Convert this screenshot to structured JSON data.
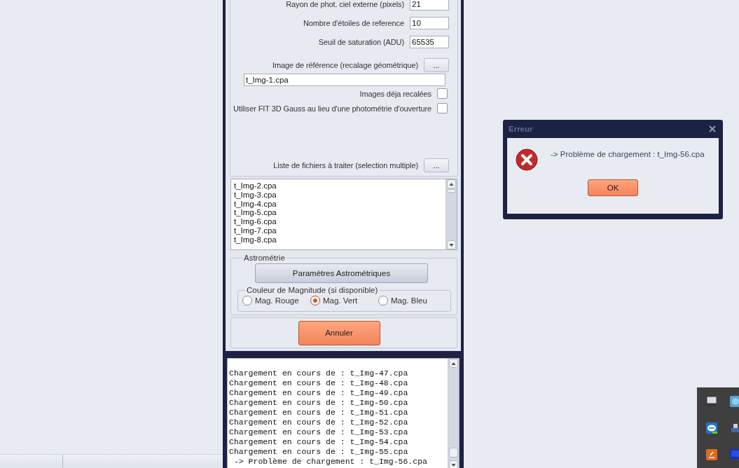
{
  "settings_window": {
    "fields": [
      {
        "label": "Rayon de phot. ciel externe (pixels)",
        "value": "21"
      },
      {
        "label": "Nombre d'étoiles de reference",
        "value": "10"
      },
      {
        "label": "Seuil de saturation (ADU)",
        "value": "65535"
      }
    ],
    "reference_image": {
      "label": "Image de référence (recalage géométrique)",
      "button": "...",
      "value": "t_Img-1.cpa"
    },
    "checkboxes": [
      {
        "label": "Images déja recalées",
        "checked": false
      },
      {
        "label": "Utiliser FIT 3D Gauss au lieu d'une photométrie d'ouverture",
        "checked": false
      }
    ],
    "file_list": {
      "label": "Liste de fichiers à traiter (selection multiple)",
      "button": "...",
      "items": [
        "t_Img-2.cpa",
        "t_Img-3.cpa",
        "t_Img-4.cpa",
        "t_Img-5.cpa",
        "t_Img-6.cpa",
        "t_Img-7.cpa",
        "t_Img-8.cpa"
      ]
    },
    "astrometry": {
      "title": "Astrométrie",
      "button": "Paramètres Astrométriques",
      "magnitude": {
        "title": "Couleur de Magnitude (si disponible)",
        "options": [
          {
            "label": "Mag. Rouge",
            "selected": false
          },
          {
            "label": "Mag. Vert",
            "selected": true
          },
          {
            "label": "Mag. Bleu",
            "selected": false
          }
        ]
      }
    },
    "cancel_button": "Annuler",
    "log": [
      "Chargement en cours de : t_Img-47.cpa",
      "Chargement en cours de : t_Img-48.cpa",
      "Chargement en cours de : t_Img-49.cpa",
      "Chargement en cours de : t_Img-50.cpa",
      "Chargement en cours de : t_Img-51.cpa",
      "Chargement en cours de : t_Img-52.cpa",
      "Chargement en cours de : t_Img-53.cpa",
      "Chargement en cours de : t_Img-54.cpa",
      "Chargement en cours de : t_Img-55.cpa",
      " -> Problème de chargement : t_Img-56.cpa"
    ]
  },
  "error_dialog": {
    "title": "Erreur",
    "message": "-> Problème de chargement : t_Img-56.cpa",
    "ok_button": "OK"
  }
}
